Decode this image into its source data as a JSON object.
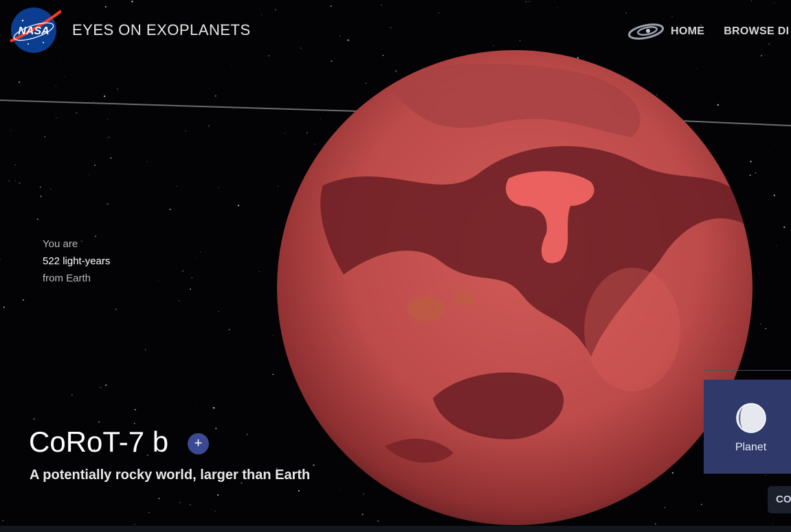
{
  "header": {
    "logo_text": "NASA",
    "title": "EYES ON EXOPLANETS",
    "nav": [
      {
        "label": "HOME",
        "icon": "galaxy-icon"
      },
      {
        "label": "BROWSE DI"
      }
    ]
  },
  "distance": {
    "prefix": "You are",
    "value": "522 light-years",
    "suffix": "from Earth"
  },
  "planet": {
    "name": "CoRoT-7 b",
    "add_label": "+",
    "tagline": "A potentially rocky world, larger than Earth",
    "surface_color": "#c8504f"
  },
  "panel": {
    "card_label": "Planet",
    "card_icon": "planet-icon",
    "secondary_button": "CO"
  },
  "colors": {
    "background": "#030305",
    "accent": "#3c4a93",
    "card": "#2f3a6b"
  }
}
